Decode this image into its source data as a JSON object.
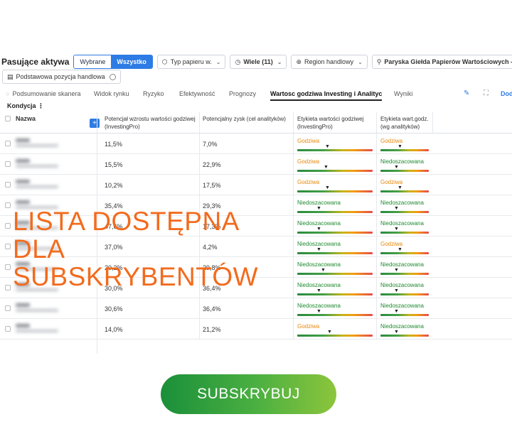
{
  "filters": {
    "title": "Pasujące aktywa",
    "seg_selected": "Wybrane",
    "seg_all": "Wszystko",
    "type_dropdown": "Typ papieru w.",
    "many_dropdown": "Wiele (11)",
    "region_dropdown": "Region handlowy",
    "exchange_dropdown": "Paryska Giełda Papierów Wartościowych — Euronext",
    "position_label": "Podstawowa pozycja handlowa"
  },
  "tabs": [
    {
      "label": "Podsumowanie skanera"
    },
    {
      "label": "Widok rynku"
    },
    {
      "label": "Ryzyko"
    },
    {
      "label": "Efektywność"
    },
    {
      "label": "Prognozy"
    },
    {
      "label": "Wartosc godziwa Investing i Analityc"
    },
    {
      "label": "Wyniki"
    }
  ],
  "tab_right_label": "Dod",
  "condition_label": "Kondycja",
  "table": {
    "headers": {
      "name": "Nazwa",
      "upside_l1": "Potencjał wzrostu wartości godziwej",
      "upside_l2": "(InvestingPro)",
      "analyst_upside": "Potencjalny zysk (cel analityków)",
      "fv_label_l1": "Etykieta wartości godziwej",
      "fv_label_l2": "(InvestingPro)",
      "fv_analyst_l1": "Etykieta wart.godz.",
      "fv_analyst_l2": "(wg analityków)"
    },
    "rows": [
      {
        "upside": "11,5%",
        "analyst": "7,0%",
        "label_pro": "Godziwa",
        "pos_pro": 0.4,
        "label_an": "Godziwa",
        "pos_an": 0.3
      },
      {
        "upside": "15,5%",
        "analyst": "22,9%",
        "label_pro": "Godziwa",
        "pos_pro": 0.38,
        "label_an": "Niedoszacowana",
        "pos_an": 0.22
      },
      {
        "upside": "10,2%",
        "analyst": "17,5%",
        "label_pro": "Godziwa",
        "pos_pro": 0.4,
        "label_an": "Godziwa",
        "pos_an": 0.3
      },
      {
        "upside": "35,4%",
        "analyst": "29,3%",
        "label_pro": "Niedoszacowana",
        "pos_pro": 0.28,
        "label_an": "Niedoszacowana",
        "pos_an": 0.22
      },
      {
        "upside": "47,6%",
        "analyst": "17,3%",
        "label_pro": "Niedoszacowana",
        "pos_pro": 0.28,
        "label_an": "Niedoszacowana",
        "pos_an": 0.22
      },
      {
        "upside": "37,0%",
        "analyst": "4,2%",
        "label_pro": "Niedoszacowana",
        "pos_pro": 0.28,
        "label_an": "Godziwa",
        "pos_an": 0.3
      },
      {
        "upside": "20,2%",
        "analyst": "29,8%",
        "label_pro": "Niedoszacowana",
        "pos_pro": 0.34,
        "label_an": "Niedoszacowana",
        "pos_an": 0.22
      },
      {
        "upside": "30,0%",
        "analyst": "36,4%",
        "label_pro": "Niedoszacowana",
        "pos_pro": 0.28,
        "label_an": "Niedoszacowana",
        "pos_an": 0.22
      },
      {
        "upside": "30,6%",
        "analyst": "36,4%",
        "label_pro": "Niedoszacowana",
        "pos_pro": 0.28,
        "label_an": "Niedoszacowana",
        "pos_an": 0.22
      },
      {
        "upside": "14,0%",
        "analyst": "21,2%",
        "label_pro": "Godziwa",
        "pos_pro": 0.42,
        "label_an": "Niedoszacowana",
        "pos_an": 0.22
      }
    ]
  },
  "overlay": {
    "line1": "LISTA DOSTĘPNA",
    "line2": "DLA",
    "line3": "SUBSKRYBENTÓW"
  },
  "cta": {
    "label": "SUBSKRYBUJ"
  },
  "colors": {
    "accent": "#2d7be4",
    "overlay_text": "#f26b1d",
    "fair": "#e8890c",
    "under": "#1d8a2e",
    "cta_start": "#1a8f3a",
    "cta_end": "#8cc53c"
  }
}
